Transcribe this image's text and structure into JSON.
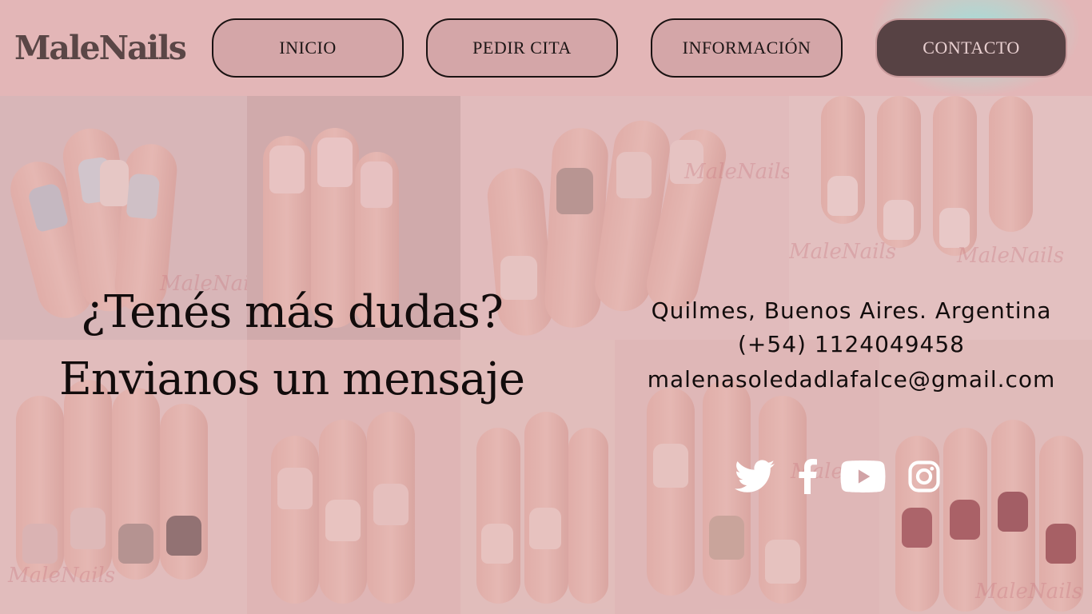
{
  "brand": {
    "logo_text": "MaleNails"
  },
  "nav": {
    "items": [
      {
        "label": "INICIO"
      },
      {
        "label": "PEDIR CITA"
      },
      {
        "label": "INFORMACIÓN"
      },
      {
        "label": "CONTACTO",
        "active": true
      }
    ]
  },
  "hero": {
    "line1": "¿Tenés más dudas?",
    "line2": "Envianos un mensaje"
  },
  "contact": {
    "location": "Quilmes, Buenos Aires. Argentina",
    "phone": "(+54) 1124049458",
    "email": "malenasoledadlafalce@gmail.com"
  },
  "social": [
    {
      "icon": "twitter-icon"
    },
    {
      "icon": "facebook-icon"
    },
    {
      "icon": "youtube-icon"
    },
    {
      "icon": "instagram-icon"
    }
  ],
  "background": {
    "watermark_text": "MaleNails"
  },
  "colors": {
    "header_bg": "#e3b6b7",
    "button_bg": "#d4a6a8",
    "active_button_bg": "#574244",
    "text_dark": "#120c0c",
    "accent_glow": "#96e6e1"
  }
}
